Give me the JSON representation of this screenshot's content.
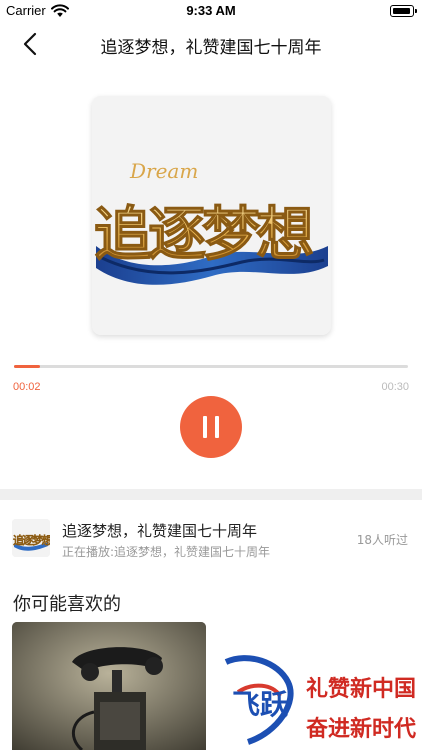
{
  "status_bar": {
    "carrier": "Carrier",
    "time": "9:33 AM"
  },
  "nav": {
    "title": "追逐梦想，礼赞建国七十周年"
  },
  "player": {
    "elapsed": "00:02",
    "total": "00:30",
    "progress_fraction": 0.067,
    "accent_color": "#f0633e",
    "cover_text": {
      "script": "Dream",
      "main": "追逐梦想"
    }
  },
  "now_playing": {
    "title": "追逐梦想，礼赞建国七十周年",
    "subtitle": "正在播放:追逐梦想，礼赞建国七十周年",
    "listen_count": "18人听过"
  },
  "recommend": {
    "heading": "你可能喜欢的",
    "items": [
      {
        "icon": "vintage-telephone"
      },
      {
        "text_line1": "礼赞新中国",
        "text_line2": "奋进新时代",
        "icon_text": "飞跃"
      }
    ]
  }
}
